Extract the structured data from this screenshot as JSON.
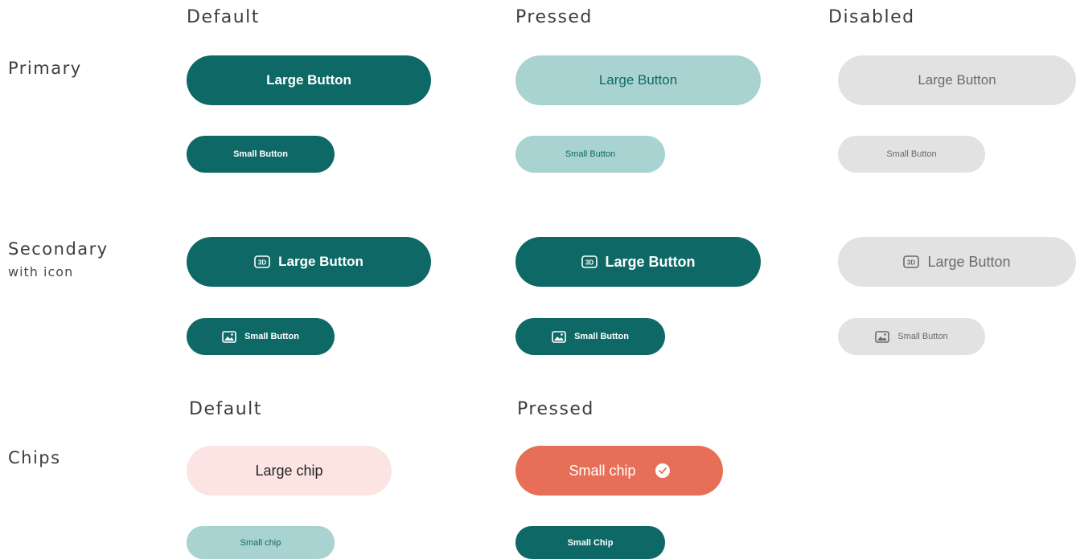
{
  "columns": {
    "default": "Default",
    "pressed": "Pressed",
    "disabled": "Disabled"
  },
  "rows": {
    "primary": "Primary",
    "secondary": "Secondary",
    "secondary_sub": "with icon",
    "chips": "Chips"
  },
  "chip_columns": {
    "default": "Default",
    "pressed": "Pressed"
  },
  "buttons": {
    "large": "Large Button",
    "small": "Small Button"
  },
  "chips": {
    "large_default": "Large chip",
    "small_default": "Small chip",
    "large_pressed": "Small chip",
    "small_pressed": "Small Chip"
  },
  "icons": {
    "large": "3d-icon",
    "small": "image-icon",
    "chip_check": "check-icon"
  },
  "colors": {
    "primary": "#0e6966",
    "pressed": "#a9d3d0",
    "disabled": "#e2e2e2",
    "chip_pink": "#fbe4e1",
    "chip_coral": "#e86f57"
  }
}
